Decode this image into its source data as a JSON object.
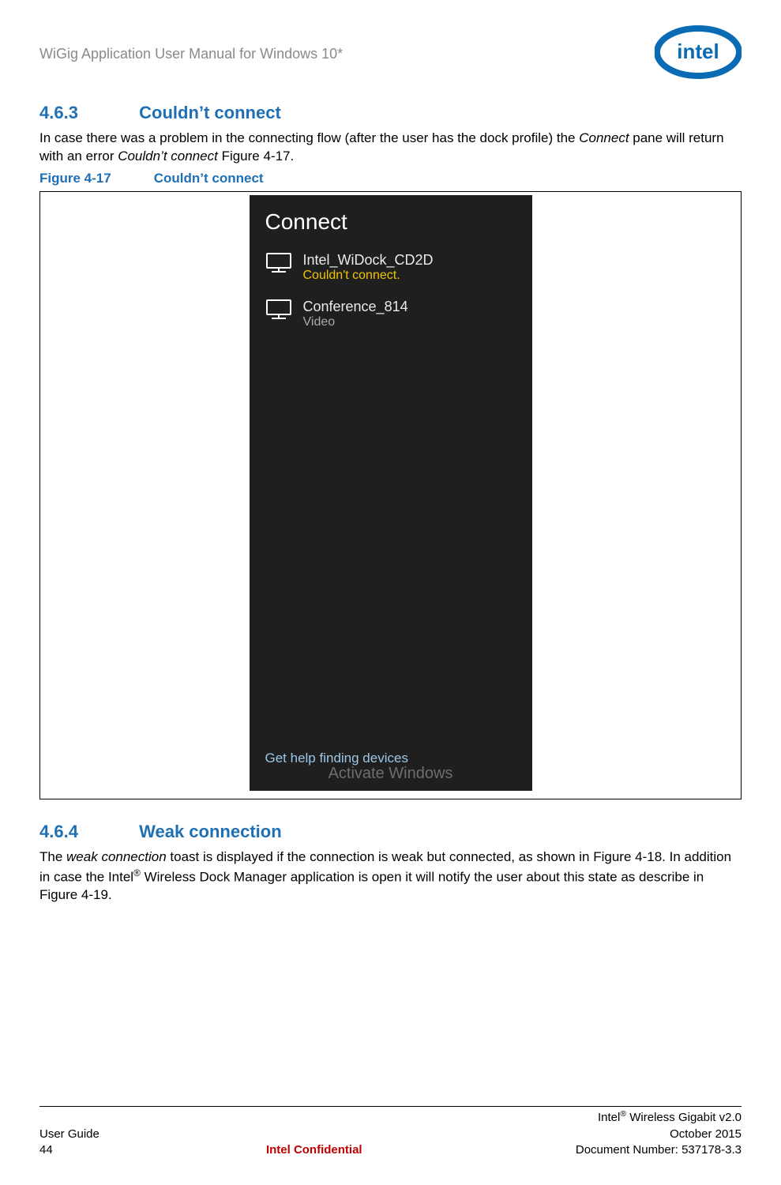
{
  "header": {
    "doc_title": "WiGig Application User Manual for Windows 10*",
    "logo_word": "intel"
  },
  "sec1": {
    "number": "4.6.3",
    "title": "Couldn’t connect",
    "para_a": "In case there was a problem in the connecting flow (after the user has the dock profile) the ",
    "para_b_italic": "Connect",
    "para_c": " pane will return with an error ",
    "para_d_italic": "Couldn’t connect",
    "para_e": " Figure 4-17."
  },
  "fig1": {
    "label_no": "Figure 4-17",
    "label_title": "Couldn’t connect",
    "pane_title": "Connect",
    "dev1_name": "Intel_WiDock_CD2D",
    "dev1_status": "Couldn't connect.",
    "dev2_name": "Conference_814",
    "dev2_status": "Video",
    "help_link": "Get help finding devices",
    "watermark": "Activate Windows"
  },
  "sec2": {
    "number": "4.6.4",
    "title": "Weak connection",
    "para_a": "The ",
    "para_b_italic": "weak connection",
    "para_c": " toast is displayed if the connection is weak but connected, as shown in Figure 4-18. In addition in case the Intel",
    "para_d_sup": "®",
    "para_e": " Wireless Dock Manager application is open it will notify the user about this state as describe in Figure 4-19."
  },
  "footer": {
    "right1_a": "Intel",
    "right1_sup": "®",
    "right1_b": " Wireless Gigabit v2.0",
    "left2": "User Guide",
    "right2": "October 2015",
    "left3": "44",
    "center3": "Intel Confidential",
    "right3": "Document Number: 537178-3.3"
  }
}
